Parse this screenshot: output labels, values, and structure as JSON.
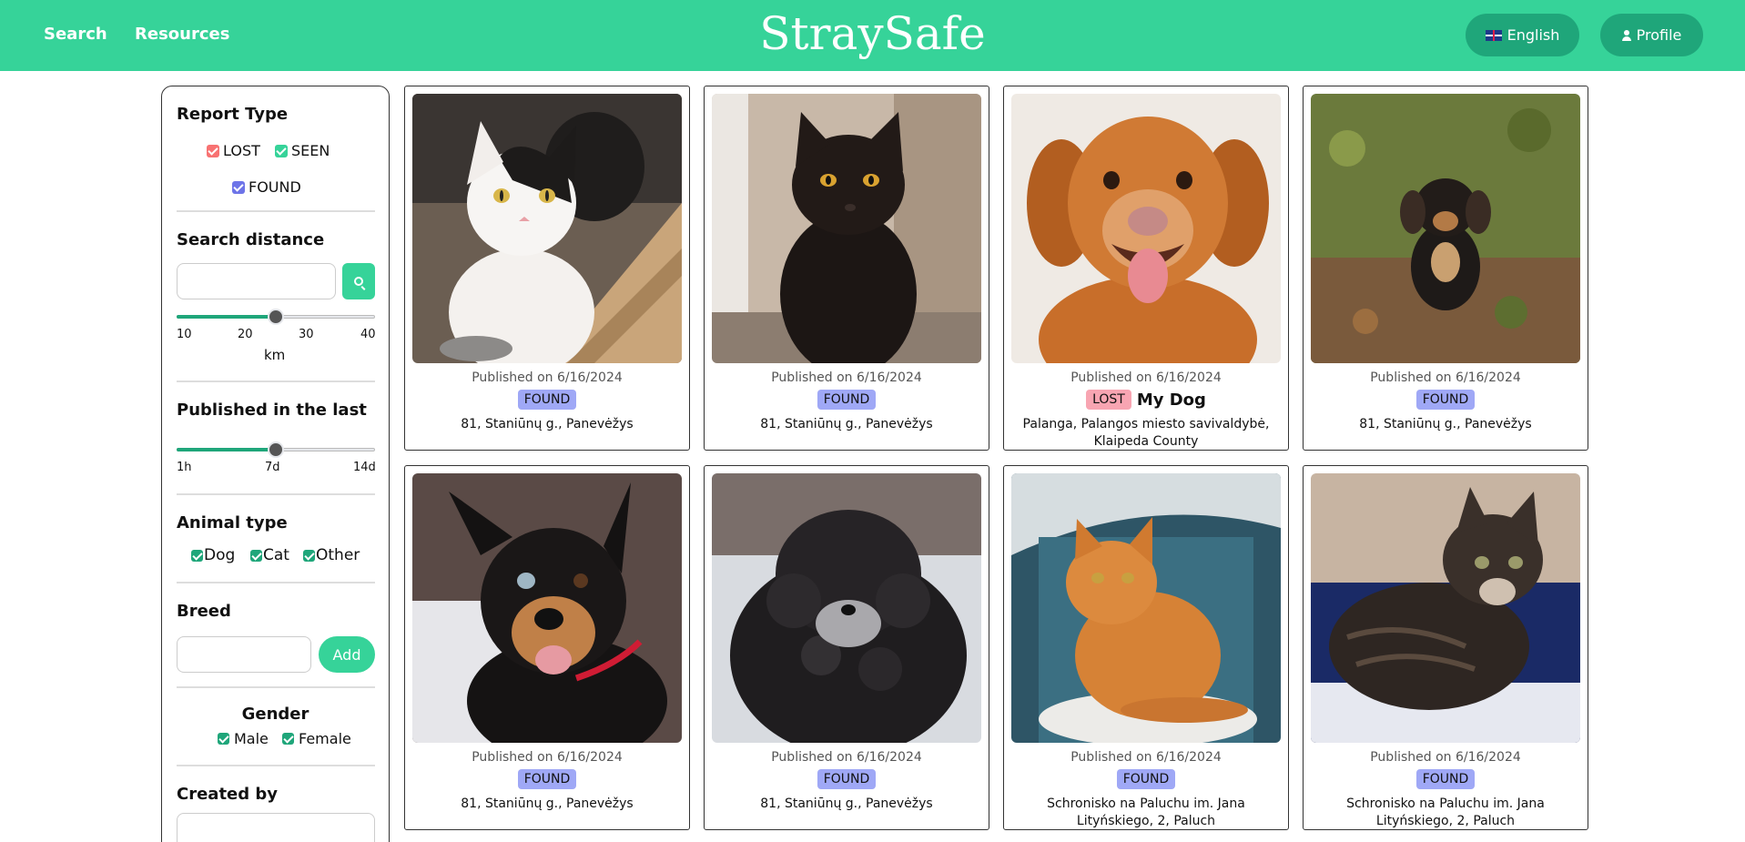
{
  "nav": {
    "links": [
      "Search",
      "Resources"
    ],
    "brand": "StraySafe",
    "language_label": "English",
    "language_flag_icon": "uk-flag-icon",
    "profile_label": "Profile",
    "profile_icon": "person-icon",
    "accent_color": "#36d399",
    "button_color": "#1fa67a"
  },
  "sidebar": {
    "report_type": {
      "title": "Report Type",
      "options": [
        {
          "label": "LOST",
          "checked": true,
          "color": "#f87272"
        },
        {
          "label": "SEEN",
          "checked": true,
          "color": "#36d399"
        },
        {
          "label": "FOUND",
          "checked": true,
          "color": "#6d74e8"
        }
      ]
    },
    "search_distance": {
      "title": "Search distance",
      "input_value": "",
      "search_icon": "magnifier-icon",
      "ticks": [
        "10",
        "20",
        "30",
        "40"
      ],
      "unit": "km",
      "value_fraction": 0.5
    },
    "published": {
      "title": "Published in the last",
      "ticks": [
        "1h",
        "7d",
        "14d"
      ],
      "value_fraction": 0.5
    },
    "animal_type": {
      "title": "Animal type",
      "options": [
        {
          "label": "Dog",
          "checked": true
        },
        {
          "label": "Cat",
          "checked": true
        },
        {
          "label": "Other",
          "checked": true
        }
      ]
    },
    "breed": {
      "title": "Breed",
      "input_value": "",
      "add_label": "Add"
    },
    "gender": {
      "title": "Gender",
      "options": [
        {
          "label": "Male",
          "checked": true
        },
        {
          "label": "Female",
          "checked": true
        }
      ]
    },
    "created_by": {
      "title": "Created by",
      "input_value": ""
    }
  },
  "cards": [
    {
      "date": "Published on 6/16/2024",
      "status": "FOUND",
      "title": "",
      "address": "81, Staniūnų g., Panevėžys",
      "photo": "white-black-cat"
    },
    {
      "date": "Published on 6/16/2024",
      "status": "FOUND",
      "title": "",
      "address": "81, Staniūnų g., Panevėžys",
      "photo": "black-cat"
    },
    {
      "date": "Published on 6/16/2024",
      "status": "LOST",
      "title": "My Dog",
      "address": "Palanga, Palangos miesto savivaldybė, Klaipeda County",
      "photo": "golden-dog"
    },
    {
      "date": "Published on 6/16/2024",
      "status": "FOUND",
      "title": "",
      "address": "81, Staniūnų g., Panevėžys",
      "photo": "small-dog-on-grass"
    },
    {
      "date": "Published on 6/16/2024",
      "status": "FOUND",
      "title": "",
      "address": "81, Staniūnų g., Panevėžys",
      "photo": "black-tan-dog"
    },
    {
      "date": "Published on 6/16/2024",
      "status": "FOUND",
      "title": "",
      "address": "81, Staniūnų g., Panevėžys",
      "photo": "curly-black-dog"
    },
    {
      "date": "Published on 6/16/2024",
      "status": "FOUND",
      "title": "",
      "address": "Schronisko na Paluchu im. Jana Lityńskiego, 2, Paluch",
      "photo": "orange-cat-in-carrier"
    },
    {
      "date": "Published on 6/16/2024",
      "status": "FOUND",
      "title": "",
      "address": "Schronisko na Paluchu im. Jana Lityńskiego, 2, Paluch",
      "photo": "tabby-cat-in-carrier"
    }
  ]
}
